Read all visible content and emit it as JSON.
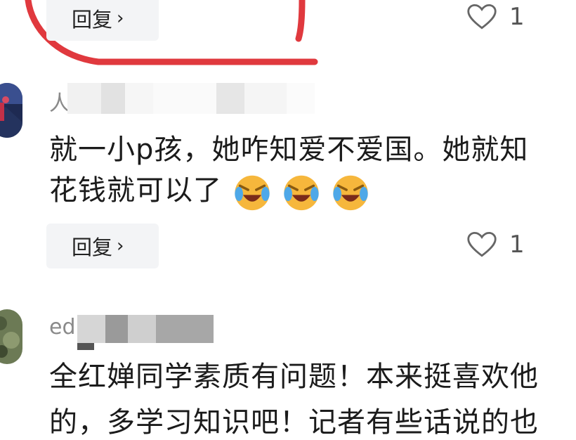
{
  "comments": [
    {
      "reply_label": "回复",
      "like_count": "1"
    },
    {
      "username": "人",
      "text_lines": [
        "就一小p孩，她咋知爱不爱国。她就知",
        "花钱就可以了"
      ],
      "emojis": [
        "laughing-crying-emoji",
        "laughing-crying-emoji",
        "laughing-crying-emoji"
      ],
      "reply_label": "回复",
      "like_count": "1"
    },
    {
      "username": "ed",
      "text_lines": [
        "全红婵同学素质有问题！本来挺喜欢他",
        "的，多学习知识吧！记者有些话说的也"
      ]
    }
  ],
  "colors": {
    "annotation_red": "#e0393e",
    "reply_bg": "#f3f4f6",
    "muted": "#8a8a8a"
  }
}
